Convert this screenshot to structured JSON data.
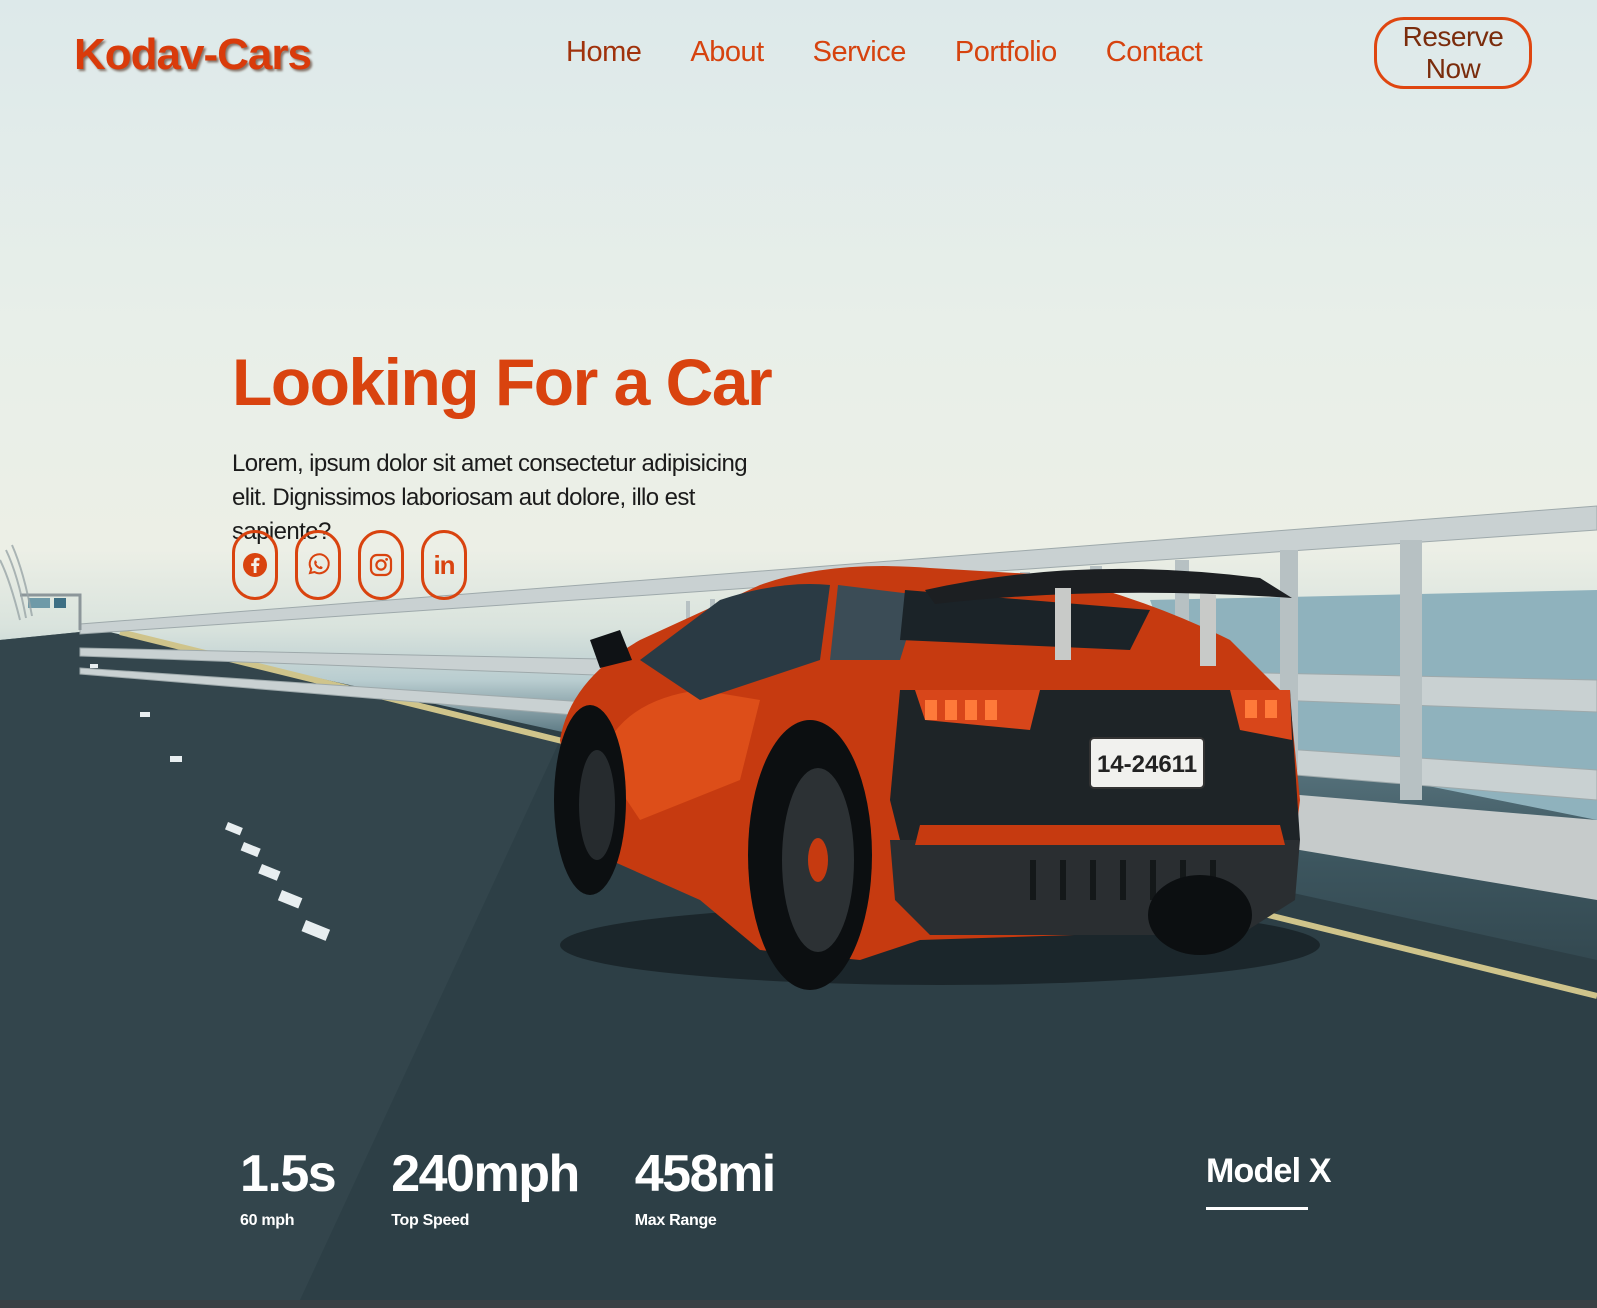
{
  "brand": {
    "logo": "Kodav-Cars"
  },
  "nav": {
    "items": [
      "Home",
      "About",
      "Service",
      "Portfolio",
      "Contact"
    ],
    "active": "Home"
  },
  "header": {
    "reserve_label": "Reserve Now"
  },
  "hero": {
    "title": "Looking For a Car",
    "description": "Lorem, ipsum dolor sit amet consectetur adipisicing elit. Dignissimos laboriosam aut dolore, illo est sapiente?",
    "car_plate": "14-24611"
  },
  "socials": [
    {
      "icon": "facebook-icon"
    },
    {
      "icon": "whatsapp-icon"
    },
    {
      "icon": "instagram-icon"
    },
    {
      "icon": "linkedin-icon",
      "glyph": "in"
    }
  ],
  "stats": [
    {
      "value": "1.5s",
      "label": "60 mph"
    },
    {
      "value": "240mph",
      "label": "Top Speed"
    },
    {
      "value": "458mi",
      "label": "Max Range"
    }
  ],
  "model": {
    "name": "Model X"
  },
  "colors": {
    "accent": "#d9430f",
    "text_dark": "#1b1b1b",
    "stats_text": "#ffffff"
  }
}
